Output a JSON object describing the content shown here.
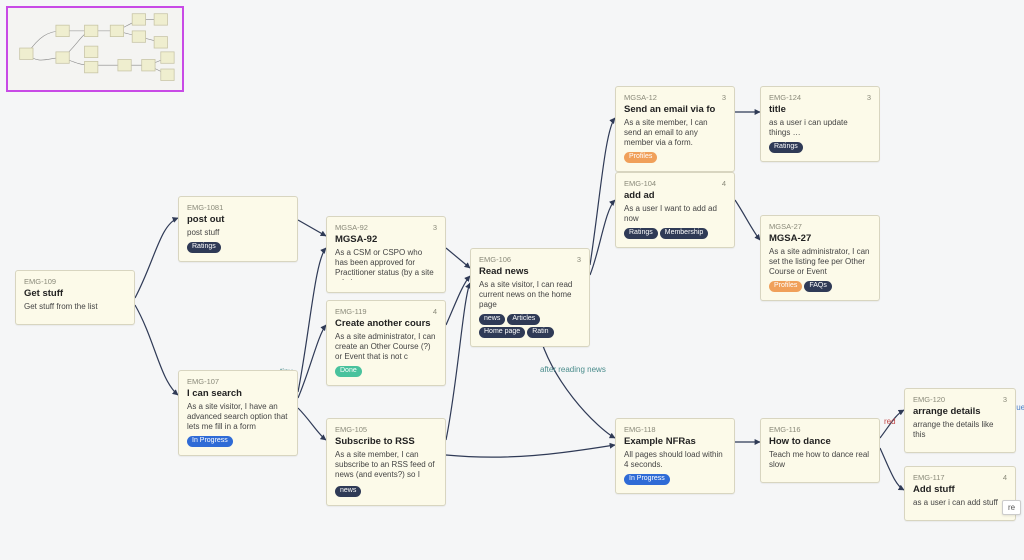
{
  "cards": {
    "getstuff": {
      "id": "EMG-109",
      "count": "",
      "title": "Get stuff",
      "desc": "Get stuff from the list",
      "tags": []
    },
    "postout": {
      "id": "EMG-1081",
      "count": "",
      "title": "post out",
      "desc": "post stuff",
      "tags": [
        {
          "text": "Ratings",
          "cls": "tag-navy"
        }
      ]
    },
    "search": {
      "id": "EMG-107",
      "count": "",
      "title": "I can search",
      "desc": "As a site visitor, I have an advanced search option that lets me fill in a form",
      "tags": [
        {
          "text": "In Progress",
          "cls": "tag-blue"
        }
      ]
    },
    "mgsa92": {
      "id": "MGSA-92",
      "count": "3",
      "title": "MGSA-92",
      "desc": "As a CSM or CSPO who has been approved for Practitioner status (by a site admin",
      "tags": []
    },
    "createcourse": {
      "id": "EMG-119",
      "count": "4",
      "title": "Create another cours",
      "desc": "As a site administrator, I can create an Other Course (?) or Event that is not c",
      "tags": [
        {
          "text": "Done",
          "cls": "tag-green"
        }
      ]
    },
    "rss": {
      "id": "EMG-105",
      "count": "",
      "title": "Subscribe to RSS",
      "desc": "As a site member, I can subscribe to an RSS feed of news (and events?) so I rema",
      "tags": [
        {
          "text": "news",
          "cls": "tag-navy"
        }
      ]
    },
    "readnews": {
      "id": "EMG-106",
      "count": "3",
      "title": "Read news",
      "desc": "As a site visitor, I can read current news on the home page",
      "tags": [
        {
          "text": "news",
          "cls": "tag-navy"
        },
        {
          "text": "Articles",
          "cls": "tag-navy"
        },
        {
          "text": "Home page",
          "cls": "tag-navy"
        },
        {
          "text": "Ratin",
          "cls": "tag-navy"
        }
      ]
    },
    "sendemail": {
      "id": "MGSA-12",
      "count": "3",
      "title": "Send an email via fo",
      "desc": "As a site member, I can send an email to any member via a form.",
      "tags": [
        {
          "text": "Profiles",
          "cls": "tag-orange"
        }
      ]
    },
    "addad": {
      "id": "EMG-104",
      "count": "4",
      "title": "add ad",
      "desc": "As a user I want to add ad now",
      "tags": [
        {
          "text": "Ratings",
          "cls": "tag-navy"
        },
        {
          "text": "Membership",
          "cls": "tag-navy"
        }
      ]
    },
    "title": {
      "id": "EMG-124",
      "count": "3",
      "title": "title",
      "desc": "as a user i can update things …",
      "tags": [
        {
          "text": "Ratings",
          "cls": "tag-navy"
        }
      ]
    },
    "mgsa27": {
      "id": "MGSA-27",
      "count": "",
      "title": "MGSA-27",
      "desc": "As a site administrator, I can set the listing fee per Other Course or Event",
      "tags": [
        {
          "text": "Profiles",
          "cls": "tag-orange"
        },
        {
          "text": "FAQs",
          "cls": "tag-navy"
        }
      ]
    },
    "nfras": {
      "id": "EMG-118",
      "count": "",
      "title": "Example NFRas",
      "desc": "All pages should load within 4 seconds.",
      "tags": [
        {
          "text": "In Progress",
          "cls": "tag-blue"
        }
      ]
    },
    "dance": {
      "id": "EMG-116",
      "count": "",
      "title": "How to dance",
      "desc": "Teach me how to dance real slow",
      "tags": []
    },
    "arrange": {
      "id": "EMG-120",
      "count": "3",
      "title": "arrange details",
      "desc": "arrange the details like this",
      "tags": []
    },
    "addstuff": {
      "id": "EMG-117",
      "count": "4",
      "title": "Add stuff",
      "desc": "as a user i can add stuff",
      "tags": []
    }
  },
  "edge_labels": {
    "tiny": "tiny",
    "after_reading": "after reading news",
    "red": "red",
    "blue": "blue",
    "re": "re"
  },
  "tooltip": "re"
}
